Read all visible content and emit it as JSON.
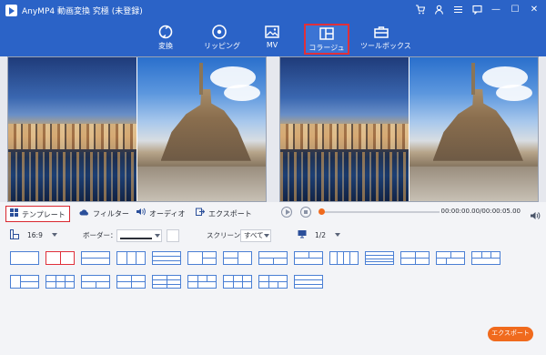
{
  "app": {
    "title": "AnyMP4 動画変換 究極 (未登録)"
  },
  "titlebar_controls": [
    {
      "name": "cart-icon"
    },
    {
      "name": "user-icon"
    },
    {
      "name": "menu-icon"
    },
    {
      "name": "feedback-icon"
    },
    {
      "name": "minimize-icon",
      "glyph": "—"
    },
    {
      "name": "maximize-icon",
      "glyph": "☐"
    },
    {
      "name": "close-icon",
      "glyph": "✕"
    }
  ],
  "nav": {
    "tabs": [
      {
        "id": "convert",
        "label": "変換",
        "icon": "convert-icon"
      },
      {
        "id": "ripper",
        "label": "リッピング",
        "icon": "disc-icon"
      },
      {
        "id": "mv",
        "label": "MV",
        "icon": "image-icon"
      },
      {
        "id": "collage",
        "label": "コラージュ",
        "icon": "collage-icon",
        "active": true
      },
      {
        "id": "toolbox",
        "label": "ツールボックス",
        "icon": "toolbox-icon"
      }
    ]
  },
  "settings_tabs": [
    {
      "label": "テンプレート",
      "icon": "template-icon",
      "active": true
    },
    {
      "label": "フィルター",
      "icon": "cloud-icon"
    },
    {
      "label": "オーディオ",
      "icon": "speaker-icon"
    },
    {
      "label": "エクスポート",
      "icon": "export-icon"
    }
  ],
  "playback": {
    "time": "00:00:00.00/00:00:05.00",
    "progress": 0.0
  },
  "options": {
    "aspect": "16:9",
    "border_label": "ボーダー：",
    "screen_label": "スクリーン：",
    "screen_value": "すべて",
    "page_value": "1/2"
  },
  "layouts": {
    "count": 23,
    "selected_index": 1
  },
  "export_button": {
    "label": "エクスポート"
  },
  "colors": {
    "brand": "#2b63c7",
    "accent": "#f06a1d",
    "highlight": "#e0303a",
    "template_line": "#4a7fd4"
  }
}
